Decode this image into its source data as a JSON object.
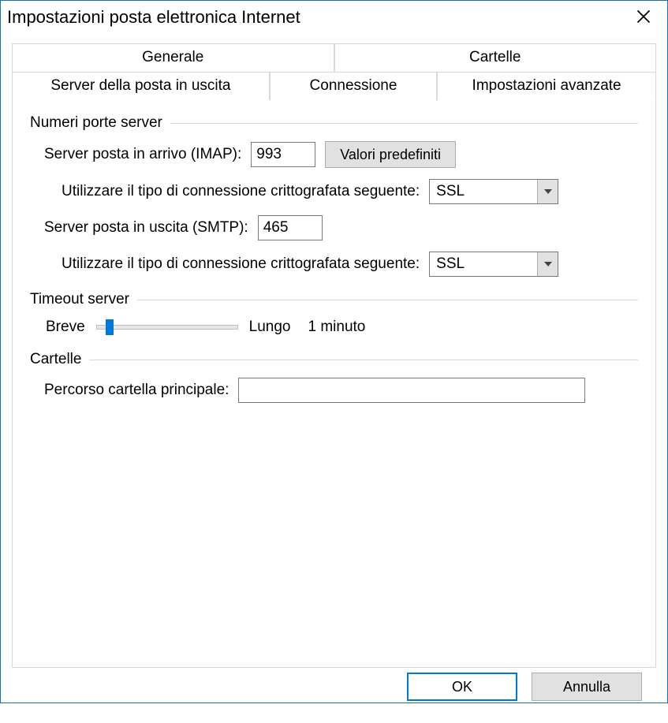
{
  "window": {
    "title": "Impostazioni posta elettronica Internet"
  },
  "tabs": {
    "generale": "Generale",
    "cartelle": "Cartelle",
    "server_uscita": "Server della posta in uscita",
    "connessione": "Connessione",
    "avanzate": "Impostazioni avanzate"
  },
  "group_ports": {
    "legend": "Numeri porte server",
    "imap_label": "Server posta in arrivo (IMAP):",
    "imap_value": "993",
    "defaults_button": "Valori predefiniti",
    "encryption_label": "Utilizzare il tipo di connessione crittografata seguente:",
    "imap_encryption": "SSL",
    "smtp_label": "Server posta in uscita (SMTP):",
    "smtp_value": "465",
    "smtp_encryption": "SSL"
  },
  "group_timeout": {
    "legend": "Timeout server",
    "short": "Breve",
    "long": "Lungo",
    "value": "1 minuto"
  },
  "group_folders": {
    "legend": "Cartelle",
    "root_label": "Percorso cartella principale:",
    "root_value": ""
  },
  "footer": {
    "ok": "OK",
    "cancel": "Annulla"
  }
}
